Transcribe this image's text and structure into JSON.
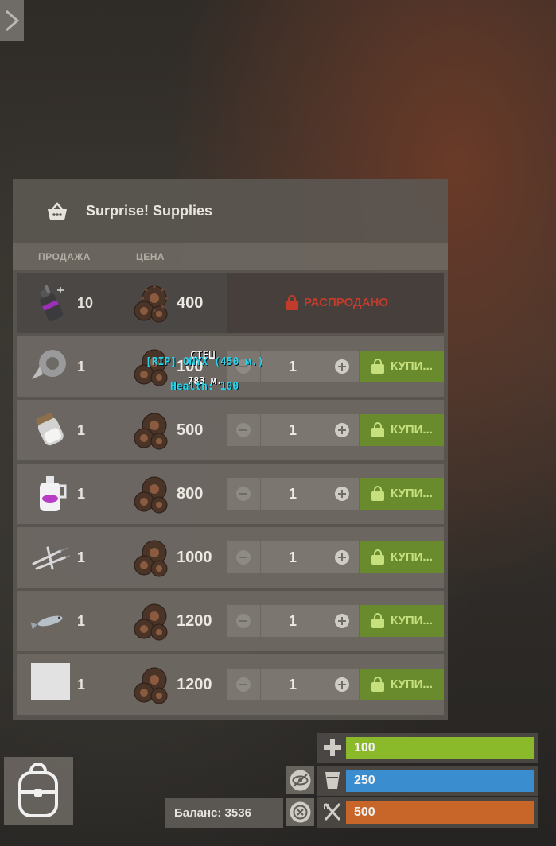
{
  "shop": {
    "title": "Surprise! Supplies",
    "col_sell": "ПРОДАЖА",
    "col_price": "ЦЕНА",
    "sold_out": "РАСПРОДАНО",
    "buy_label": "КУПИ...",
    "rows": [
      {
        "item_icon": "smoke-grenade-icon",
        "qty": "10",
        "price": "400",
        "status": "sold-out"
      },
      {
        "item_icon": "duct-tape-icon",
        "qty": "1",
        "price": "100",
        "amount": "1"
      },
      {
        "item_icon": "jar-icon",
        "qty": "1",
        "price": "500",
        "amount": "1"
      },
      {
        "item_icon": "bleach-bottle-icon",
        "qty": "1",
        "price": "800",
        "amount": "1"
      },
      {
        "item_icon": "syringes-icon",
        "qty": "1",
        "price": "1000",
        "amount": "1"
      },
      {
        "item_icon": "fish-icon",
        "qty": "1",
        "price": "1200",
        "amount": "1"
      },
      {
        "item_icon": "blank-item-icon",
        "qty": "1",
        "price": "1200",
        "amount": "1"
      }
    ]
  },
  "overlay": {
    "name": "СТЕШ",
    "clan_line": "[RIP] ONYX (450 м.)",
    "distance": "783 м.",
    "health": "Health: 100"
  },
  "hud": {
    "balance": "Баланс: 3536",
    "health": {
      "value": "100",
      "color": "#8ab92a"
    },
    "water": {
      "value": "250",
      "color": "#3a8ed0"
    },
    "food": {
      "value": "500",
      "color": "#c8662a"
    }
  }
}
